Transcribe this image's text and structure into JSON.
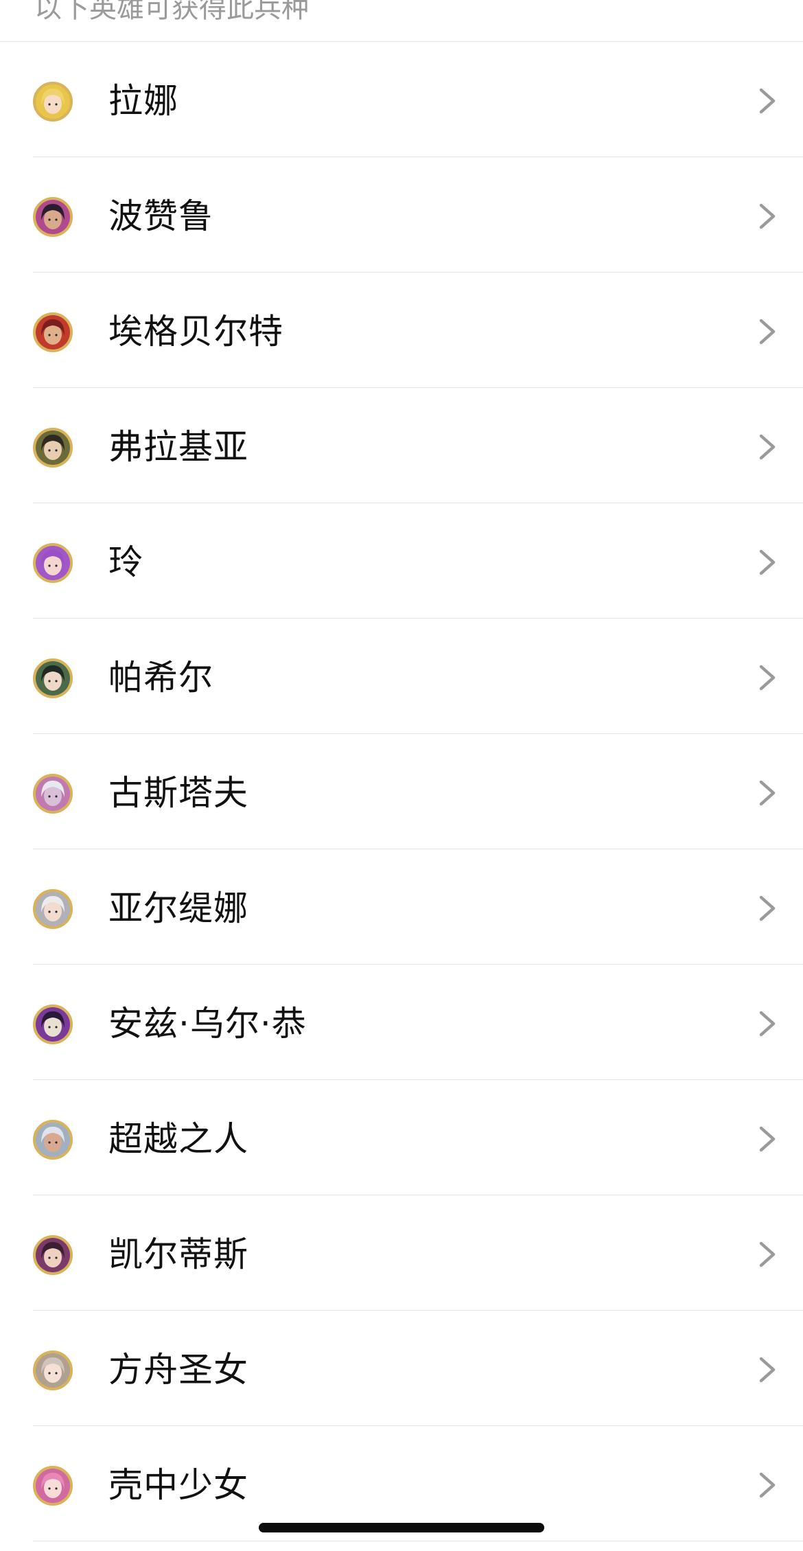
{
  "header": {
    "subtitle": "以下英雄可获得此兵种"
  },
  "heroes": [
    {
      "name": "拉娜",
      "avatar_icon": "hero-portrait-icon",
      "accent": "#e8c64a",
      "hair": "#f0d26a",
      "skin": "#f6dcc4"
    },
    {
      "name": "波赞鲁",
      "avatar_icon": "hero-portrait-icon",
      "accent": "#b04a8c",
      "hair": "#2a1e2e",
      "skin": "#d9a98c"
    },
    {
      "name": "埃格贝尔特",
      "avatar_icon": "hero-portrait-icon",
      "accent": "#c23a2a",
      "hair": "#7a1f1f",
      "skin": "#e0b08a"
    },
    {
      "name": "弗拉基亚",
      "avatar_icon": "hero-portrait-icon",
      "accent": "#6b6b3a",
      "hair": "#2e2a20",
      "skin": "#e8cdb0"
    },
    {
      "name": "玲",
      "avatar_icon": "hero-portrait-icon",
      "accent": "#a058c8",
      "hair": "#9b4fc4",
      "skin": "#f4d6d0"
    },
    {
      "name": "帕希尔",
      "avatar_icon": "hero-portrait-icon",
      "accent": "#4a6a4a",
      "hair": "#1f2a22",
      "skin": "#f0d8c8"
    },
    {
      "name": "古斯塔夫",
      "avatar_icon": "hero-portrait-icon",
      "accent": "#c07ab0",
      "hair": "#e8e8f0",
      "skin": "#d8c0d8"
    },
    {
      "name": "亚尔缇娜",
      "avatar_icon": "hero-portrait-icon",
      "accent": "#b0b0b8",
      "hair": "#ececec",
      "skin": "#f2dcd0"
    },
    {
      "name": "安兹·乌尔·恭",
      "avatar_icon": "hero-portrait-icon",
      "accent": "#7a3a9a",
      "hair": "#2a1a3a",
      "skin": "#e8e0d0"
    },
    {
      "name": "超越之人",
      "avatar_icon": "hero-portrait-icon",
      "accent": "#a0b0c0",
      "hair": "#e0e4ea",
      "skin": "#d8a890"
    },
    {
      "name": "凯尔蒂斯",
      "avatar_icon": "hero-portrait-icon",
      "accent": "#7a3a6a",
      "hair": "#3a2030",
      "skin": "#f0d0c0"
    },
    {
      "name": "方舟圣女",
      "avatar_icon": "hero-portrait-icon",
      "accent": "#b0a090",
      "hair": "#cfc4bc",
      "skin": "#f4e0d4"
    },
    {
      "name": "壳中少女",
      "avatar_icon": "hero-portrait-icon",
      "accent": "#d06aa0",
      "hair": "#e888b8",
      "skin": "#f8dcd8"
    }
  ],
  "chevron_icon": "chevron-right-icon",
  "colors": {
    "divider": "#e3e3e3",
    "header_text": "#9a9a9a",
    "name_text": "#111111",
    "chevron": "#9a9a9a",
    "avatar_ring": "#d9b25a"
  }
}
